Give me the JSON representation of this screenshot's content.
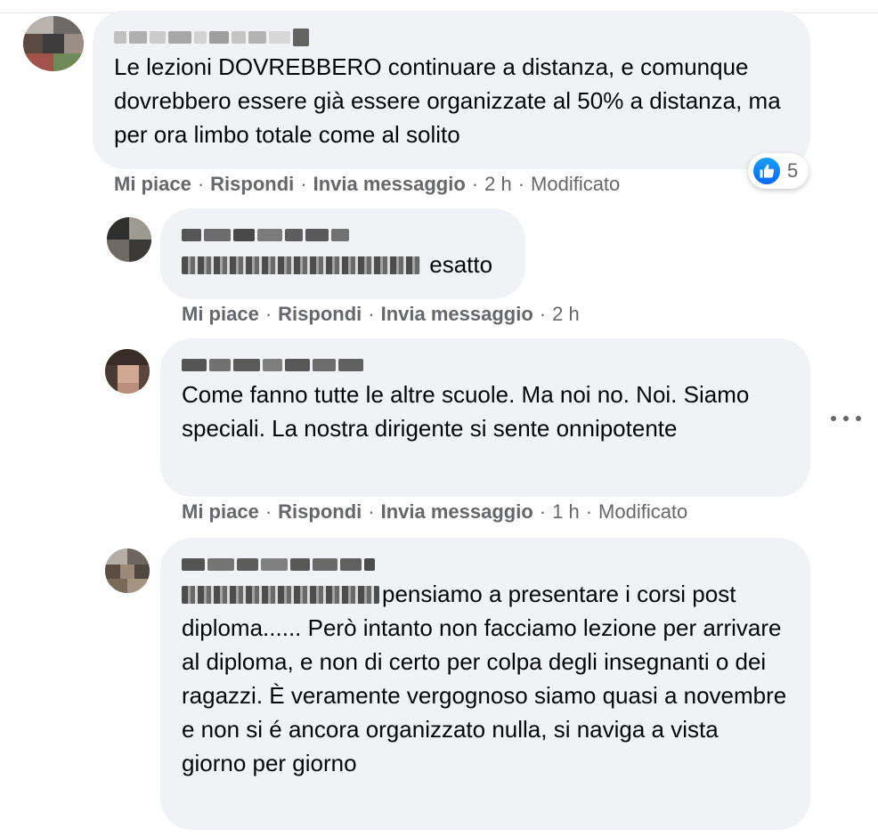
{
  "actions": {
    "like": "Mi piace",
    "reply": "Rispondi",
    "message": "Invia messaggio",
    "separator": "·",
    "edited": "Modificato"
  },
  "comments": [
    {
      "text": "Le lezioni DOVREBBERO continuare a distanza, e comunque dovrebbero essere già essere organizzate al 50% a distanza, ma per ora limbo totale come al solito",
      "time": "2 h",
      "reactions": {
        "icon": "like-icon",
        "count": "5"
      }
    },
    {
      "text": "esatto",
      "time": "2 h"
    },
    {
      "text": "Come fanno tutte le altre scuole. Ma noi no. Noi. Siamo speciali. La nostra dirigente si sente onnipotente",
      "time": "1 h"
    },
    {
      "text": "pensiamo a presentare i corsi post diploma...... Però intanto non facciamo lezione per arrivare al diploma, e non di certo per colpa degli insegnanti o dei ragazzi. È veramente vergognoso siamo quasi a novembre e non si é ancora organizzato nulla, si naviga a vista giorno per giorno"
    }
  ],
  "colors": {
    "bubble": "#f0f2f5",
    "secondary_text": "#65676b",
    "like_blue": "#0866ff"
  }
}
